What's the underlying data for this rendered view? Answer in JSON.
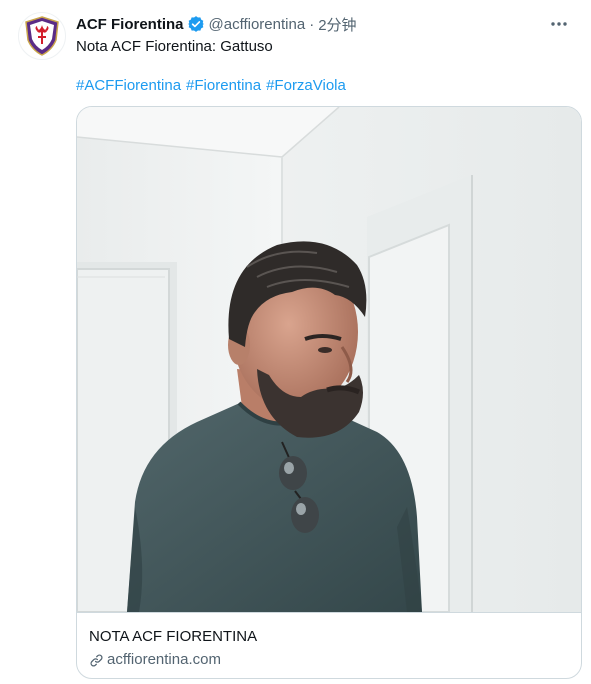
{
  "tweet": {
    "author_name": "ACF Fiorentina",
    "handle": "@acffiorentina",
    "separator": "·",
    "time": "2分钟",
    "text": "Nota ACF Fiorentina: Gattuso",
    "hashtags": [
      "#ACFFiorentina",
      "#Fiorentina",
      "#ForzaViola"
    ]
  },
  "card": {
    "title": "NOTA ACF FIORENTINA",
    "domain": "acffiorentina.com"
  },
  "colors": {
    "link": "#1d9bf0",
    "secondary_text": "#536471",
    "border": "#cfd9de",
    "club_purple": "#5b2c86",
    "shirt": "#46585b"
  },
  "icons": {
    "verified": "verified-badge-icon",
    "more": "more-dots-icon",
    "link": "link-icon"
  }
}
